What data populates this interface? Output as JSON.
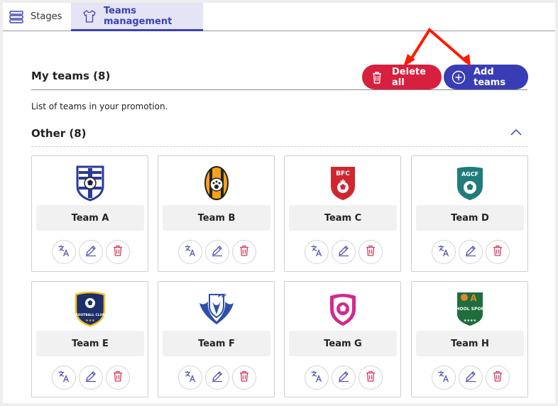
{
  "tabs": [
    {
      "label": "Stages",
      "icon": "stack-icon"
    },
    {
      "label": "Teams management",
      "icon": "jersey-icon",
      "active": true
    }
  ],
  "section": {
    "title": "My teams (8)",
    "description": "List of teams in your promotion."
  },
  "buttons": {
    "delete_all": "Delete all",
    "add_teams": "Add teams"
  },
  "group": {
    "title": "Other (8)"
  },
  "colors": {
    "accent": "#383db6",
    "danger": "#d71f3f",
    "annotation_arrow": "#ff1a00"
  },
  "teams": [
    {
      "name": "Team A",
      "logo_text": ""
    },
    {
      "name": "Team B",
      "logo_text": ""
    },
    {
      "name": "Team C",
      "logo_text": "BFC"
    },
    {
      "name": "Team D",
      "logo_text": "AGCF"
    },
    {
      "name": "Team E",
      "logo_text": "FOOTBALL CLUB"
    },
    {
      "name": "Team F",
      "logo_text": "FIF"
    },
    {
      "name": "Team G",
      "logo_text": ""
    },
    {
      "name": "Team H",
      "logo_text": "SCHOOL SPORTS"
    }
  ]
}
